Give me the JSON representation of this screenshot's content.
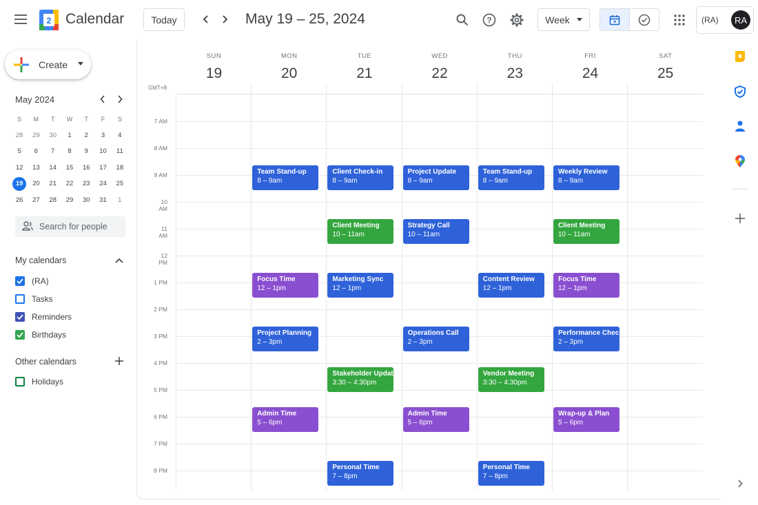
{
  "app": {
    "title": "Calendar",
    "logo_number": "2"
  },
  "header": {
    "today_label": "Today",
    "date_range": "May 19 – 25, 2024",
    "view_label": "Week",
    "account_label": "(RA)",
    "avatar_initials": "RA"
  },
  "sidebar": {
    "create_label": "Create",
    "mini_calendar": {
      "title": "May 2024",
      "weekdays": [
        "S",
        "M",
        "T",
        "W",
        "T",
        "F",
        "S"
      ],
      "weeks": [
        [
          "28",
          "29",
          "30",
          "1",
          "2",
          "3",
          "4"
        ],
        [
          "5",
          "6",
          "7",
          "8",
          "9",
          "10",
          "11"
        ],
        [
          "12",
          "13",
          "14",
          "15",
          "16",
          "17",
          "18"
        ],
        [
          "19",
          "20",
          "21",
          "22",
          "23",
          "24",
          "25"
        ],
        [
          "26",
          "27",
          "28",
          "29",
          "30",
          "31",
          "1"
        ]
      ],
      "selected": "19"
    },
    "people_search_placeholder": "Search for people",
    "my_calendars": {
      "title": "My calendars",
      "items": [
        {
          "label": "(RA)",
          "color": "#1a73e8",
          "checked": true
        },
        {
          "label": "Tasks",
          "color": "#1a73e8",
          "checked": false
        },
        {
          "label": "Reminders",
          "color": "#3f51b5",
          "checked": true
        },
        {
          "label": "Birthdays",
          "color": "#33a852",
          "checked": true
        }
      ]
    },
    "other_calendars": {
      "title": "Other calendars",
      "items": [
        {
          "label": "Holidays",
          "color": "#0b8043",
          "checked": false
        }
      ]
    }
  },
  "week": {
    "timezone": "GMT+8",
    "days": [
      {
        "dow": "SUN",
        "num": "19"
      },
      {
        "dow": "MON",
        "num": "20"
      },
      {
        "dow": "TUE",
        "num": "21"
      },
      {
        "dow": "WED",
        "num": "22"
      },
      {
        "dow": "THU",
        "num": "23"
      },
      {
        "dow": "FRI",
        "num": "24"
      },
      {
        "dow": "SAT",
        "num": "25"
      }
    ],
    "hours": [
      "7 AM",
      "8 AM",
      "9 AM",
      "10 AM",
      "11 AM",
      "12 PM",
      "1 PM",
      "2 PM",
      "3 PM",
      "4 PM",
      "5 PM",
      "6 PM",
      "7 PM",
      "8 PM"
    ],
    "first_hour": 7
  },
  "colors": {
    "blue": "#2f62d9",
    "green": "#34a63f",
    "purple": "#8a4fd0",
    "accent": "#1a73e8"
  },
  "events": [
    {
      "day": 1,
      "start": 8,
      "end": 9,
      "title": "Team Stand-up",
      "time": "8 – 9am",
      "color": "blue"
    },
    {
      "day": 2,
      "start": 8,
      "end": 9,
      "title": "Client Check-in",
      "time": "8 – 9am",
      "color": "blue"
    },
    {
      "day": 3,
      "start": 8,
      "end": 9,
      "title": "Project Update",
      "time": "8 – 9am",
      "color": "blue"
    },
    {
      "day": 4,
      "start": 8,
      "end": 9,
      "title": "Team Stand-up",
      "time": "8 – 9am",
      "color": "blue"
    },
    {
      "day": 5,
      "start": 8,
      "end": 9,
      "title": "Weekly Review",
      "time": "8 – 9am",
      "color": "blue"
    },
    {
      "day": 2,
      "start": 10,
      "end": 11,
      "title": "Client Meeting",
      "time": "10 – 11am",
      "color": "green"
    },
    {
      "day": 3,
      "start": 10,
      "end": 11,
      "title": "Strategy Call",
      "time": "10 – 11am",
      "color": "blue"
    },
    {
      "day": 5,
      "start": 10,
      "end": 11,
      "title": "Client Meeting",
      "time": "10 – 11am",
      "color": "green"
    },
    {
      "day": 1,
      "start": 12,
      "end": 13,
      "title": "Focus Time",
      "time": "12 – 1pm",
      "color": "purple"
    },
    {
      "day": 2,
      "start": 12,
      "end": 13,
      "title": "Marketing Sync",
      "time": "12 – 1pm",
      "color": "blue"
    },
    {
      "day": 4,
      "start": 12,
      "end": 13,
      "title": "Content Review",
      "time": "12 – 1pm",
      "color": "blue"
    },
    {
      "day": 5,
      "start": 12,
      "end": 13,
      "title": "Focus Time",
      "time": "12 – 1pm",
      "color": "purple"
    },
    {
      "day": 1,
      "start": 14,
      "end": 15,
      "title": "Project Planning",
      "time": "2 – 3pm",
      "color": "blue"
    },
    {
      "day": 3,
      "start": 14,
      "end": 15,
      "title": "Operations Call",
      "time": "2 – 3pm",
      "color": "blue"
    },
    {
      "day": 5,
      "start": 14,
      "end": 15,
      "title": "Performance Check",
      "time": "2 – 3pm",
      "color": "blue"
    },
    {
      "day": 2,
      "start": 15.5,
      "end": 16.5,
      "title": "Stakeholder Update",
      "time": "3:30 – 4:30pm",
      "color": "green"
    },
    {
      "day": 4,
      "start": 15.5,
      "end": 16.5,
      "title": "Vendor Meeting",
      "time": "3:30 – 4:30pm",
      "color": "green"
    },
    {
      "day": 1,
      "start": 17,
      "end": 18,
      "title": "Admin Time",
      "time": "5 – 6pm",
      "color": "purple"
    },
    {
      "day": 3,
      "start": 17,
      "end": 18,
      "title": "Admin Time",
      "time": "5 – 6pm",
      "color": "purple"
    },
    {
      "day": 5,
      "start": 17,
      "end": 18,
      "title": "Wrap-up & Plan",
      "time": "5 – 6pm",
      "color": "purple"
    },
    {
      "day": 2,
      "start": 19,
      "end": 20,
      "title": "Personal Time",
      "time": "7 – 8pm",
      "color": "blue"
    },
    {
      "day": 4,
      "start": 19,
      "end": 20,
      "title": "Personal Time",
      "time": "7 – 8pm",
      "color": "blue"
    }
  ],
  "side_panel": {
    "items": [
      {
        "icon": "keep-icon",
        "color": "#fbbc04"
      },
      {
        "icon": "tasks-icon",
        "color": "#1a73e8"
      },
      {
        "icon": "contacts-icon",
        "color": "#1a73e8"
      },
      {
        "icon": "maps-icon",
        "color": "#34a853"
      }
    ]
  }
}
